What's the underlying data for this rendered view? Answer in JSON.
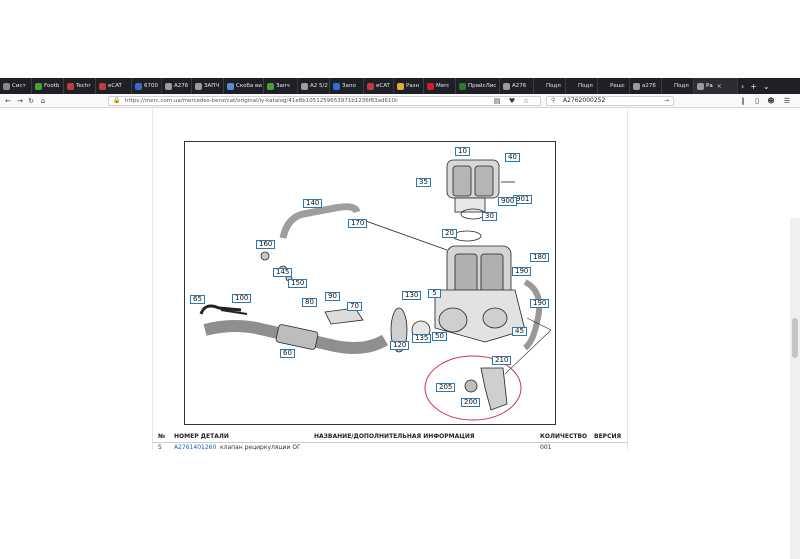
{
  "tabs": [
    {
      "label": "Сист",
      "color": "#888888"
    },
    {
      "label": "Footb",
      "color": "#4a9e3a"
    },
    {
      "label": "Techr",
      "color": "#c23b3b"
    },
    {
      "label": "eCAT",
      "color": "#c23b3b"
    },
    {
      "label": "6700",
      "color": "#3a6bc2"
    },
    {
      "label": "A276",
      "color": "#9b9b9b"
    },
    {
      "label": "ЗАПЧ",
      "color": "#9b9b9b"
    },
    {
      "label": "Скоба ви",
      "color": "#5a8ad0"
    },
    {
      "label": "Запч",
      "color": "#4a9e3a"
    },
    {
      "label": "A2 5/2",
      "color": "#9b9b9b"
    },
    {
      "label": "Запо",
      "color": "#2b6fd0"
    },
    {
      "label": "eCAT",
      "color": "#c23b3b"
    },
    {
      "label": "Разн",
      "color": "#e0b030"
    },
    {
      "label": "Merc",
      "color": "#d02020"
    },
    {
      "label": "ПрайсЛис",
      "color": "#2f7a30"
    },
    {
      "label": "A276",
      "color": "#9b9b9b"
    },
    {
      "label": "Подл",
      "color": "#1e1f27"
    },
    {
      "label": "Подл",
      "color": "#1e1f27"
    },
    {
      "label": "Решс",
      "color": "#1e1f27"
    },
    {
      "label": "a276",
      "color": "#9b9b9b"
    },
    {
      "label": "Подл",
      "color": "#1e1f27"
    },
    {
      "label": "Ра",
      "color": "#9b9b9b",
      "active": true
    }
  ],
  "nav": {
    "url": "https://merc.com.ua/mercedes-benz/cat/original/iy-katalog/41e8b1051259653971b1236f83ad610c",
    "search_value": "A2762000252"
  },
  "diagram": {
    "callouts": [
      "10",
      "40",
      "35",
      "901",
      "900",
      "30",
      "20",
      "140",
      "170",
      "160",
      "145",
      "150",
      "180",
      "190",
      "190",
      "65",
      "100",
      "80",
      "90",
      "70",
      "130",
      "5",
      "120",
      "135",
      "50",
      "45",
      "60",
      "210",
      "205",
      "200",
      "4"
    ]
  },
  "table": {
    "headers": {
      "num": "№",
      "part": "НОМЕР ДЕТАЛИ",
      "name": "НАЗВАНИЕ/ДОПОЛНИТЕЛЬНАЯ ИНФОРМАЦИЯ",
      "qty": "КОЛИЧЕСТВО",
      "ver": "ВЕРСИЯ"
    },
    "row": {
      "num": "5",
      "part": "A2761401260",
      "name": "клапан рециркуляции ОГ",
      "qty": "001"
    }
  }
}
